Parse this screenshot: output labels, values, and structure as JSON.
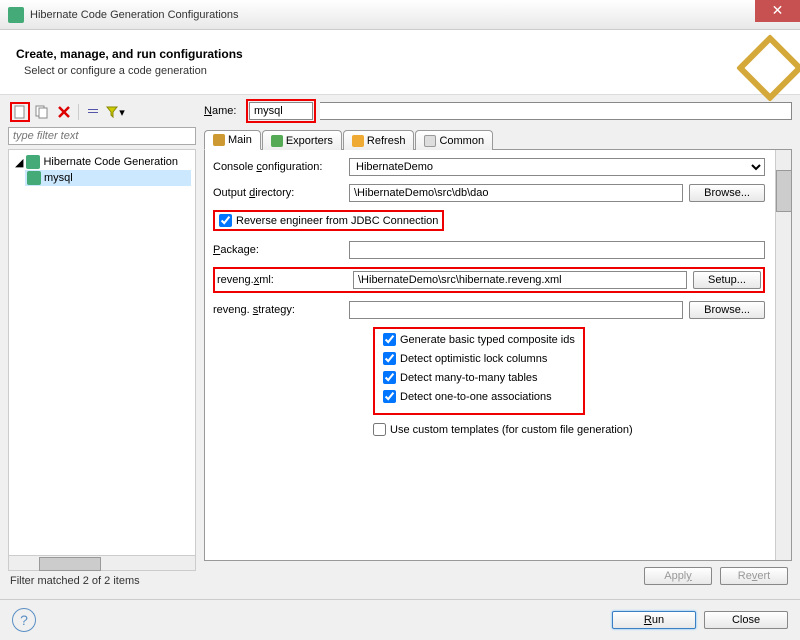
{
  "titlebar": {
    "title": "Hibernate Code Generation Configurations"
  },
  "header": {
    "title": "Create, manage, and run configurations",
    "subtitle": "Select or configure a code generation"
  },
  "sidebar": {
    "filter_placeholder": "type filter text",
    "items": [
      {
        "label": "Hibernate Code Generation"
      },
      {
        "label": "mysql"
      }
    ],
    "filter_status": "Filter matched 2 of 2 items"
  },
  "form": {
    "name_label": "Name:",
    "name_value": "mysql",
    "tabs": [
      "Main",
      "Exporters",
      "Refresh",
      "Common"
    ],
    "console_label": "Console configuration:",
    "console_value": "HibernateDemo",
    "outdir_label": "Output directory:",
    "outdir_value": "\\HibernateDemo\\src\\db\\dao",
    "browse": "Browse...",
    "reverse_label": "Reverse engineer from JDBC Connection",
    "package_label": "Package:",
    "package_value": "",
    "reveng_label": "reveng.xml:",
    "reveng_value": "\\HibernateDemo\\src\\hibernate.reveng.xml",
    "setup": "Setup...",
    "strategy_label": "reveng. strategy:",
    "strategy_value": "",
    "checks": [
      "Generate basic typed composite ids",
      "Detect optimistic lock columns",
      "Detect many-to-many tables",
      "Detect one-to-one associations"
    ],
    "custom_templates": "Use custom templates (for custom file generation)"
  },
  "buttons": {
    "apply": "Apply",
    "revert": "Revert",
    "run": "Run",
    "close": "Close"
  }
}
